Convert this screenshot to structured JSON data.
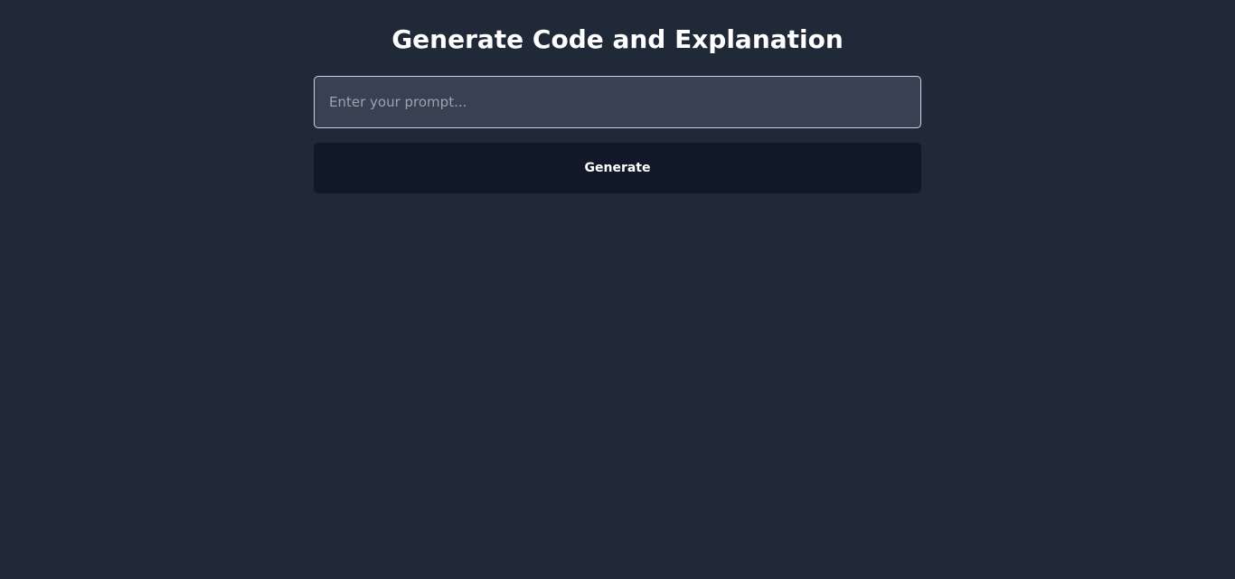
{
  "header": {
    "title": "Generate Code and Explanation"
  },
  "prompt": {
    "value": "",
    "placeholder": "Enter your prompt..."
  },
  "actions": {
    "generate_label": "Generate"
  },
  "colors": {
    "page_background": "#1f2937",
    "input_background": "#374151",
    "input_border": "#cbd5e1",
    "button_background": "#111827",
    "text": "#ffffff",
    "placeholder": "#9ca3af"
  }
}
